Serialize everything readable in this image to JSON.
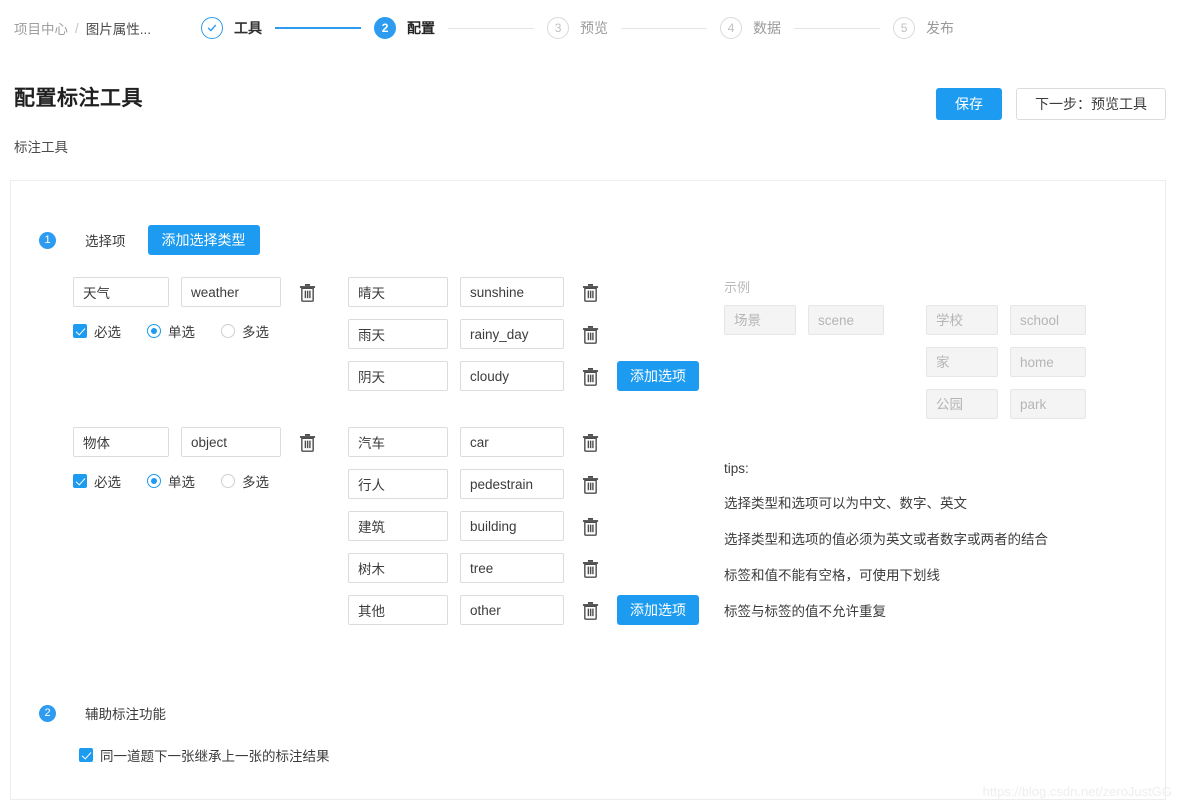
{
  "breadcrumb": {
    "items": [
      "项目中心",
      "图片属性..."
    ],
    "separator": "/"
  },
  "stepper": {
    "steps": [
      {
        "marker": "check-icon",
        "label": "工具",
        "state": "done"
      },
      {
        "marker": "2",
        "label": "配置",
        "state": "active"
      },
      {
        "marker": "3",
        "label": "预览",
        "state": "todo"
      },
      {
        "marker": "4",
        "label": "数据",
        "state": "todo"
      },
      {
        "marker": "5",
        "label": "发布",
        "state": "todo"
      }
    ]
  },
  "page": {
    "title": "配置标注工具",
    "subtitle": "标注工具",
    "save_label": "保存",
    "next_label": "下一步：预览工具"
  },
  "section1": {
    "number": "1",
    "title": "选择项",
    "add_type_label": "添加选择类型",
    "add_option_label": "添加选项",
    "groups": [
      {
        "label_cn": "天气",
        "label_en": "weather",
        "required_label": "必选",
        "required_checked": true,
        "single_label": "单选",
        "single_checked": true,
        "multi_label": "多选",
        "multi_checked": false,
        "options": [
          {
            "cn": "晴天",
            "en": "sunshine"
          },
          {
            "cn": "雨天",
            "en": "rainy_day"
          },
          {
            "cn": "阴天",
            "en": "cloudy"
          }
        ]
      },
      {
        "label_cn": "物体",
        "label_en": "object",
        "required_label": "必选",
        "required_checked": true,
        "single_label": "单选",
        "single_checked": true,
        "multi_label": "多选",
        "multi_checked": false,
        "options": [
          {
            "cn": "汽车",
            "en": "car"
          },
          {
            "cn": "行人",
            "en": "pedestrain"
          },
          {
            "cn": "建筑",
            "en": "building"
          },
          {
            "cn": "树木",
            "en": "tree"
          },
          {
            "cn": "其他",
            "en": "other"
          }
        ]
      }
    ]
  },
  "example": {
    "title": "示例",
    "left": [
      {
        "cn": "场景",
        "en": "scene"
      }
    ],
    "right": [
      {
        "cn": "学校",
        "en": "school"
      },
      {
        "cn": "家",
        "en": "home"
      },
      {
        "cn": "公园",
        "en": "park"
      }
    ]
  },
  "tips": {
    "heading": "tips:",
    "items": [
      "选择类型和选项可以为中文、数字、英文",
      "选择类型和选项的值必须为英文或者数字或两者的结合",
      "标签和值不能有空格，可使用下划线",
      "标签与标签的值不允许重复"
    ]
  },
  "section2": {
    "number": "2",
    "title": "辅助标注功能",
    "inherit_label": "同一道题下一张继承上一张的标注结果",
    "inherit_checked": true
  },
  "watermark": "https://blog.csdn.net/zeroJustGG",
  "colors": {
    "accent": "#1c9bf0",
    "step_active": "#2d9cf0",
    "border": "#dcdcdc"
  }
}
